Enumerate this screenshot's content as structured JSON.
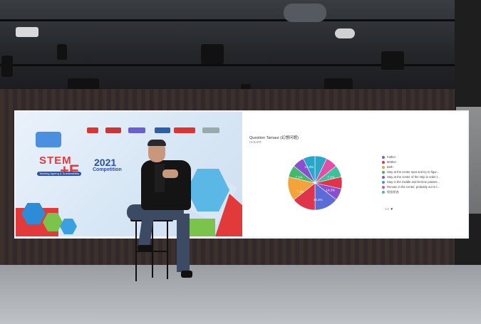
{
  "stage_slide": {
    "stem_text": "STEM",
    "plus_e": "+E",
    "year": "2021",
    "competition": "Competition",
    "tagline": "Tackling Ageing & Sustainability"
  },
  "poll": {
    "question": "Question Tamaur (幻想问题)",
    "sub": "HOLIER",
    "legend": [
      {
        "label": "Father",
        "color": "#5b6bd8"
      },
      {
        "label": "Mother",
        "color": "#e0344a"
      },
      {
        "label": "Both",
        "color": "#f3a33a"
      },
      {
        "label": "Stay at the center spot and try to figur...",
        "color": "#46b86b"
      },
      {
        "label": "Stay at the center of the strip in order t...",
        "color": "#8a4fd0"
      },
      {
        "label": "Stay in the middle and let time passes...",
        "color": "#2aa6c8"
      },
      {
        "label": "Remain in the center, probably out in t...",
        "color": "#e04ea7"
      },
      {
        "label": "短信状态",
        "color": "#3fbf9a"
      }
    ],
    "pager": "1/2",
    "pie_labels": [
      "7.1%",
      "14.3%",
      "14.3%",
      "7.1%",
      "7.1%",
      "14.3%"
    ],
    "slices": [
      {
        "value": 7.1,
        "color": "#2aa6c8"
      },
      {
        "value": 7.1,
        "color": "#e04ea7"
      },
      {
        "value": 7.1,
        "color": "#3fbf9a"
      },
      {
        "value": 7.1,
        "color": "#e0344a"
      },
      {
        "value": 7.1,
        "color": "#8a4fd0"
      },
      {
        "value": 14.3,
        "color": "#5b6bd8"
      },
      {
        "value": 14.3,
        "color": "#e0344a"
      },
      {
        "value": 14.3,
        "color": "#f3a33a"
      },
      {
        "value": 7.1,
        "color": "#46b86b"
      },
      {
        "value": 7.1,
        "color": "#8a4fd0"
      },
      {
        "value": 7.1,
        "color": "#2aa6c8"
      }
    ]
  }
}
